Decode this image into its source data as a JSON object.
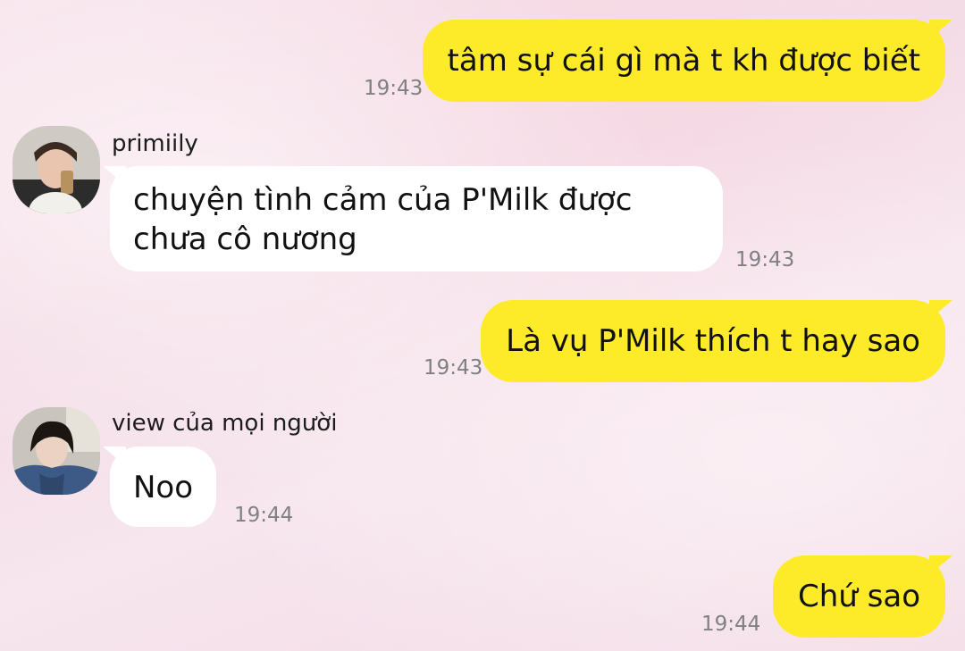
{
  "messages": [
    {
      "type": "sent",
      "text": "tâm sự cái gì mà t kh được biết",
      "time": "19:43"
    },
    {
      "type": "received",
      "sender": "primiily",
      "avatar": "avatar-primiily",
      "lines": [
        "chuyện tình cảm của P'Milk được",
        "chưa cô nương"
      ],
      "time": "19:43"
    },
    {
      "type": "sent",
      "text": "Là vụ P'Milk thích t hay sao",
      "time": "19:43"
    },
    {
      "type": "received",
      "sender": "view của mọi người",
      "avatar": "avatar-view",
      "lines": [
        "Noo"
      ],
      "time": "19:44"
    },
    {
      "type": "sent",
      "text": "Chứ sao",
      "time": "19:44"
    }
  ],
  "colors": {
    "sent_bubble": "#fdeb2a",
    "received_bubble": "#ffffff",
    "timestamp": "#808080",
    "background": "#f6e0ea"
  }
}
